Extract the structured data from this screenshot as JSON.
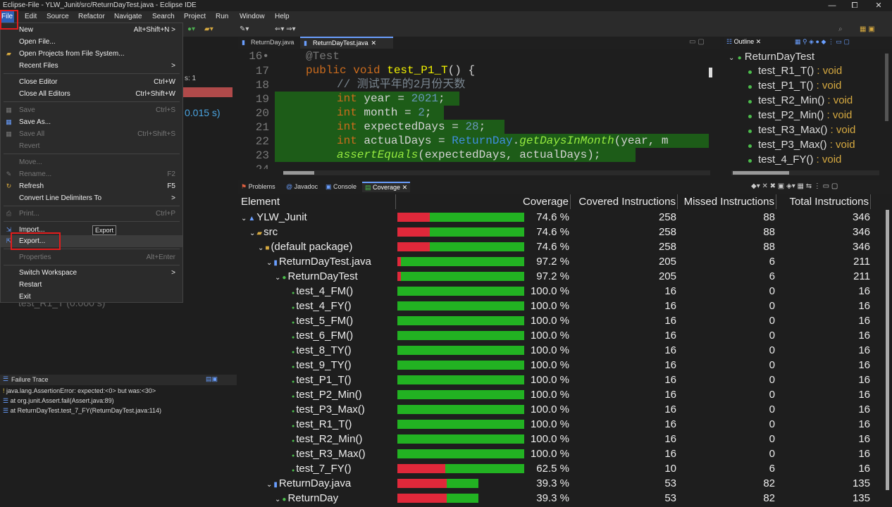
{
  "window": {
    "title": "Eclipse-File - YLW_Junit/src/ReturnDayTest.java - Eclipse IDE",
    "minimize": "—",
    "maximize": "⧠",
    "close": "✕"
  },
  "menubar": [
    "File",
    "Edit",
    "Source",
    "Refactor",
    "Navigate",
    "Search",
    "Project",
    "Run",
    "Window",
    "Help"
  ],
  "file_menu": {
    "new": {
      "label": "New",
      "shortcut": "Alt+Shift+N >"
    },
    "open_file": {
      "label": "Open File..."
    },
    "open_projects": {
      "label": "Open Projects from File System..."
    },
    "recent_files": {
      "label": "Recent Files",
      "shortcut": ">"
    },
    "close_editor": {
      "label": "Close Editor",
      "shortcut": "Ctrl+W"
    },
    "close_all": {
      "label": "Close All Editors",
      "shortcut": "Ctrl+Shift+W"
    },
    "save": {
      "label": "Save",
      "shortcut": "Ctrl+S"
    },
    "save_as": {
      "label": "Save As..."
    },
    "save_all": {
      "label": "Save All",
      "shortcut": "Ctrl+Shift+S"
    },
    "revert": {
      "label": "Revert"
    },
    "move": {
      "label": "Move..."
    },
    "rename": {
      "label": "Rename...",
      "shortcut": "F2"
    },
    "refresh": {
      "label": "Refresh",
      "shortcut": "F5"
    },
    "convert": {
      "label": "Convert Line Delimiters To",
      "shortcut": ">"
    },
    "print": {
      "label": "Print...",
      "shortcut": "Ctrl+P"
    },
    "import": {
      "label": "Import...",
      "tooltip": "Export"
    },
    "export": {
      "label": "Export..."
    },
    "properties": {
      "label": "Properties",
      "shortcut": "Alt+Enter"
    },
    "switch_ws": {
      "label": "Switch Workspace",
      "shortcut": ">"
    },
    "restart": {
      "label": "Restart"
    },
    "exit": {
      "label": "Exit"
    }
  },
  "left_panel": {
    "runs_frag": "s: 1",
    "time_frag": "0.015 s)",
    "hidden_item": "test_R1_T (0.000 s)",
    "failure_trace_title": "Failure Trace",
    "trace": [
      "java.lang.AssertionError: expected:<0> but was:<30>",
      "at org.junit.Assert.fail(Assert.java:89)",
      "at ReturnDayTest.test_7_FY(ReturnDayTest.java:114)"
    ]
  },
  "editor": {
    "tabs": [
      "ReturnDay.java",
      "ReturnDayTest.java"
    ],
    "line_numbers": [
      "16•",
      "17",
      "18",
      "19",
      "20",
      "21",
      "22",
      "23",
      "24"
    ],
    "lines": {
      "l16": "@Test",
      "l17_kw": "public void",
      "l17_name": " test_P1_T",
      "l17_rest": "() {",
      "l18": "// 测试平年的2月份天数",
      "l19_kw": "int",
      "l19_rest": " year = ",
      "l19_num": "2021",
      "l19_end": ";",
      "l20_kw": "int",
      "l20_rest": " month = ",
      "l20_num": "2",
      "l20_end": ";",
      "l21_kw": "int",
      "l21_rest": " expectedDays = ",
      "l21_num": "28",
      "l21_end": ";",
      "l22_kw": "int",
      "l22_rest": " actualDays = ",
      "l22_cls": "ReturnDay",
      "l22_dot": ".",
      "l22_mth": "getDaysInMonth",
      "l22_end": "(year, m",
      "l23_mth": "assertEquals",
      "l23_end": "(expectedDays, actualDays);"
    }
  },
  "outline": {
    "tab": "Outline",
    "class": "ReturnDayTest",
    "items": [
      {
        "n": "test_R1_T()",
        "t": " : void"
      },
      {
        "n": "test_P1_T()",
        "t": " : void"
      },
      {
        "n": "test_R2_Min()",
        "t": " : void"
      },
      {
        "n": "test_P2_Min()",
        "t": " : void"
      },
      {
        "n": "test_R3_Max()",
        "t": " : void"
      },
      {
        "n": "test_P3_Max()",
        "t": " : void"
      },
      {
        "n": "test_4_FY()",
        "t": " : void"
      }
    ]
  },
  "bottom_tabs": [
    "Problems",
    "Javadoc",
    "Console",
    "Coverage"
  ],
  "coverage": {
    "headers": [
      "Element",
      "Coverage",
      "Covered Instructions",
      "Missed Instructions",
      "Total Instructions"
    ],
    "rows": [
      {
        "name": "YLW_Junit",
        "pct": "74.6 %",
        "cov": "258",
        "mis": "88",
        "tot": "346",
        "ratio": 0.746
      },
      {
        "name": "src",
        "pct": "74.6 %",
        "cov": "258",
        "mis": "88",
        "tot": "346",
        "ratio": 0.746
      },
      {
        "name": "(default package)",
        "pct": "74.6 %",
        "cov": "258",
        "mis": "88",
        "tot": "346",
        "ratio": 0.746
      },
      {
        "name": "ReturnDayTest.java",
        "pct": "97.2 %",
        "cov": "205",
        "mis": "6",
        "tot": "211",
        "ratio": 0.972
      },
      {
        "name": "ReturnDayTest",
        "pct": "97.2 %",
        "cov": "205",
        "mis": "6",
        "tot": "211",
        "ratio": 0.972
      },
      {
        "name": "test_4_FM()",
        "pct": "100.0 %",
        "cov": "16",
        "mis": "0",
        "tot": "16",
        "ratio": 1.0
      },
      {
        "name": "test_4_FY()",
        "pct": "100.0 %",
        "cov": "16",
        "mis": "0",
        "tot": "16",
        "ratio": 1.0
      },
      {
        "name": "test_5_FM()",
        "pct": "100.0 %",
        "cov": "16",
        "mis": "0",
        "tot": "16",
        "ratio": 1.0
      },
      {
        "name": "test_6_FM()",
        "pct": "100.0 %",
        "cov": "16",
        "mis": "0",
        "tot": "16",
        "ratio": 1.0
      },
      {
        "name": "test_8_TY()",
        "pct": "100.0 %",
        "cov": "16",
        "mis": "0",
        "tot": "16",
        "ratio": 1.0
      },
      {
        "name": "test_9_TY()",
        "pct": "100.0 %",
        "cov": "16",
        "mis": "0",
        "tot": "16",
        "ratio": 1.0
      },
      {
        "name": "test_P1_T()",
        "pct": "100.0 %",
        "cov": "16",
        "mis": "0",
        "tot": "16",
        "ratio": 1.0
      },
      {
        "name": "test_P2_Min()",
        "pct": "100.0 %",
        "cov": "16",
        "mis": "0",
        "tot": "16",
        "ratio": 1.0
      },
      {
        "name": "test_P3_Max()",
        "pct": "100.0 %",
        "cov": "16",
        "mis": "0",
        "tot": "16",
        "ratio": 1.0
      },
      {
        "name": "test_R1_T()",
        "pct": "100.0 %",
        "cov": "16",
        "mis": "0",
        "tot": "16",
        "ratio": 1.0
      },
      {
        "name": "test_R2_Min()",
        "pct": "100.0 %",
        "cov": "16",
        "mis": "0",
        "tot": "16",
        "ratio": 1.0
      },
      {
        "name": "test_R3_Max()",
        "pct": "100.0 %",
        "cov": "16",
        "mis": "0",
        "tot": "16",
        "ratio": 1.0
      },
      {
        "name": "test_7_FY()",
        "pct": "62.5 %",
        "cov": "10",
        "mis": "6",
        "tot": "16",
        "ratio": 0.625
      },
      {
        "name": "ReturnDay.java",
        "pct": "39.3 %",
        "cov": "53",
        "mis": "82",
        "tot": "135",
        "ratio": 0.393
      },
      {
        "name": "ReturnDay",
        "pct": "39.3 %",
        "cov": "53",
        "mis": "82",
        "tot": "135",
        "ratio": 0.393
      }
    ]
  }
}
